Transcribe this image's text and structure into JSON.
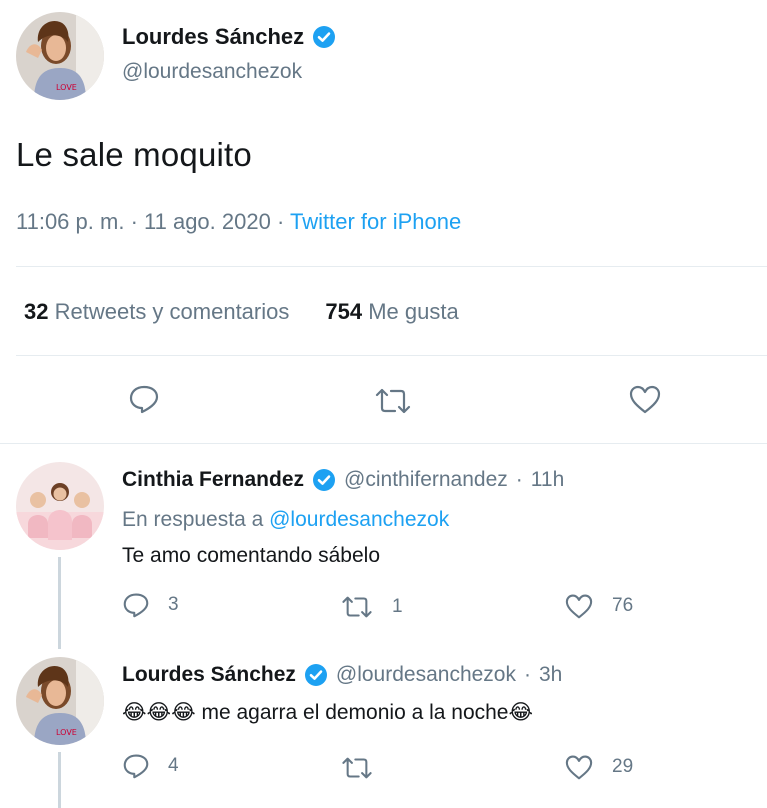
{
  "main_tweet": {
    "name": "Lourdes Sánchez",
    "handle": "@lourdesanchezok",
    "text": "Le sale moquito",
    "time": "11:06 p. m.",
    "sep1": "·",
    "date": "11 ago. 2020",
    "sep2": "·",
    "source": "Twitter for iPhone",
    "retweets_count": "32",
    "retweets_label": "Retweets y comentarios",
    "likes_count": "754",
    "likes_label": "Me gusta"
  },
  "replies": [
    {
      "name": "Cinthia Fernandez",
      "handle": "@cinthifernandez",
      "sep": "·",
      "time": "11h",
      "in_reply_prefix": "En respuesta a",
      "in_reply_handle": "@lourdesanchezok",
      "text": "Te amo comentando sábelo",
      "reply_count": "3",
      "retweet_count": "1",
      "like_count": "76"
    },
    {
      "name": "Lourdes Sánchez",
      "handle": "@lourdesanchezok",
      "sep": "·",
      "time": "3h",
      "emoji_prefix": "😂😂😂",
      "text": "me agarra el demonio a la noche",
      "emoji_suffix": "😂",
      "reply_count": "4",
      "retweet_count": "",
      "like_count": "29"
    }
  ],
  "icons": {
    "verified": "verified-badge-icon",
    "reply": "reply-icon",
    "retweet": "retweet-icon",
    "like": "heart-icon"
  },
  "colors": {
    "accent": "#1da1f2",
    "secondary_text": "#657786",
    "primary_text": "#14171a",
    "divider": "#e6ecf0"
  }
}
